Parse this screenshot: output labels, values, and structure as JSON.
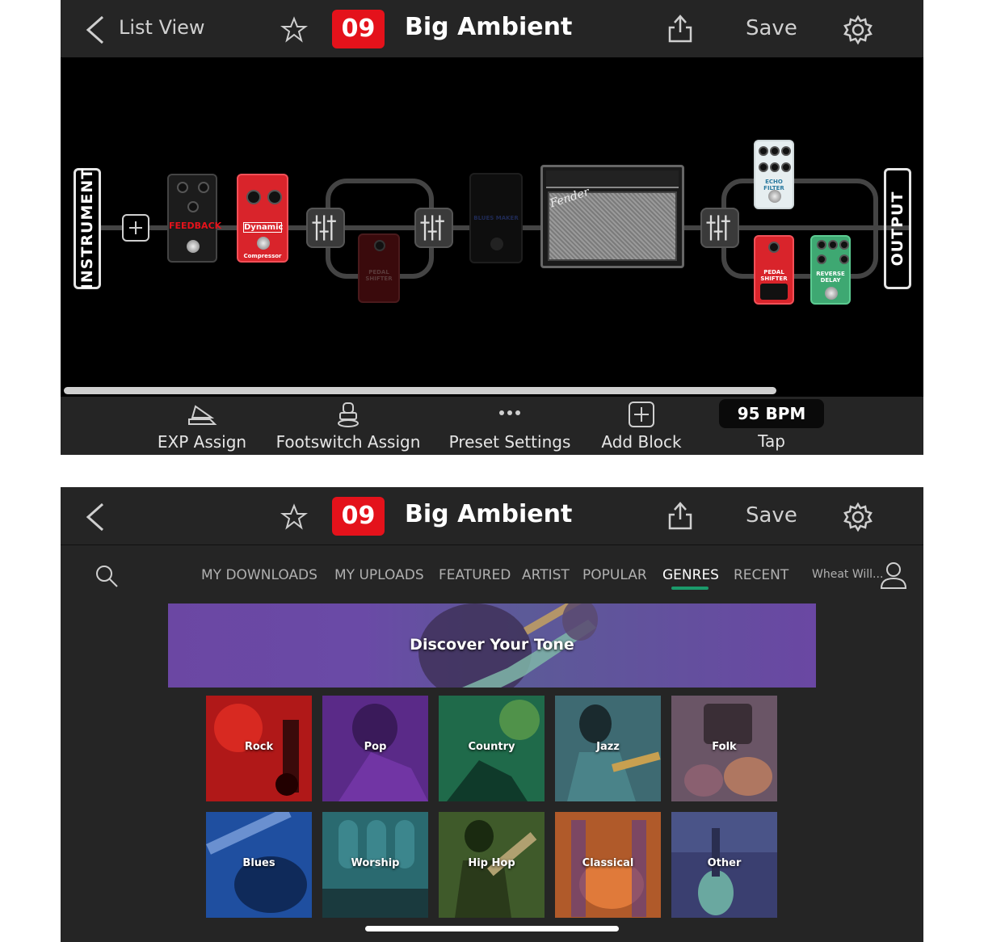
{
  "header": {
    "list_view": "List View",
    "preset_number": "09",
    "preset_name": "Big Ambient",
    "save": "Save"
  },
  "chain": {
    "input_label": "INSTRUMENT",
    "output_label": "OUTPUT",
    "pedals": {
      "feedback": "FEEDBACK",
      "dynamic": "Dynamic",
      "compressor": "Compressor",
      "pedal_shifter": "PEDAL SHIFTER",
      "blues_maker": "BLUES MAKER",
      "echo_filter": "ECHO FILTER",
      "reverse_delay": "REVERSE DELAY",
      "amp_logo": "Fender"
    }
  },
  "toolbar": {
    "exp_assign": "EXP Assign",
    "footswitch_assign": "Footswitch Assign",
    "preset_settings": "Preset Settings",
    "add_block": "Add Block",
    "bpm": "95 BPM",
    "tap": "Tap"
  },
  "tabs": [
    {
      "label": "MY DOWNLOADS"
    },
    {
      "label": "MY UPLOADS"
    },
    {
      "label": "FEATURED"
    },
    {
      "label": "ARTIST"
    },
    {
      "label": "POPULAR"
    },
    {
      "label": "GENRES"
    },
    {
      "label": "RECENT"
    }
  ],
  "active_tab": "GENRES",
  "user": {
    "name": "Wheat Will..."
  },
  "banner": {
    "title": "Discover Your Tone"
  },
  "genres": [
    {
      "label": "Rock",
      "color": "#b01818"
    },
    {
      "label": "Pop",
      "color": "#5a2a88"
    },
    {
      "label": "Country",
      "color": "#1f6a4a"
    },
    {
      "label": "Jazz",
      "color": "#3e6a72"
    },
    {
      "label": "Folk",
      "color": "#6a5566"
    },
    {
      "label": "Blues",
      "color": "#1f4fa0"
    },
    {
      "label": "Worship",
      "color": "#2a6a70"
    },
    {
      "label": "Hip Hop",
      "color": "#3f5a2a"
    },
    {
      "label": "Classical",
      "color": "#b05a2a"
    },
    {
      "label": "Other",
      "color": "#3a3f70"
    }
  ],
  "colors": {
    "accent_red": "#e4121b",
    "tab_underline": "#1b9a6b"
  }
}
